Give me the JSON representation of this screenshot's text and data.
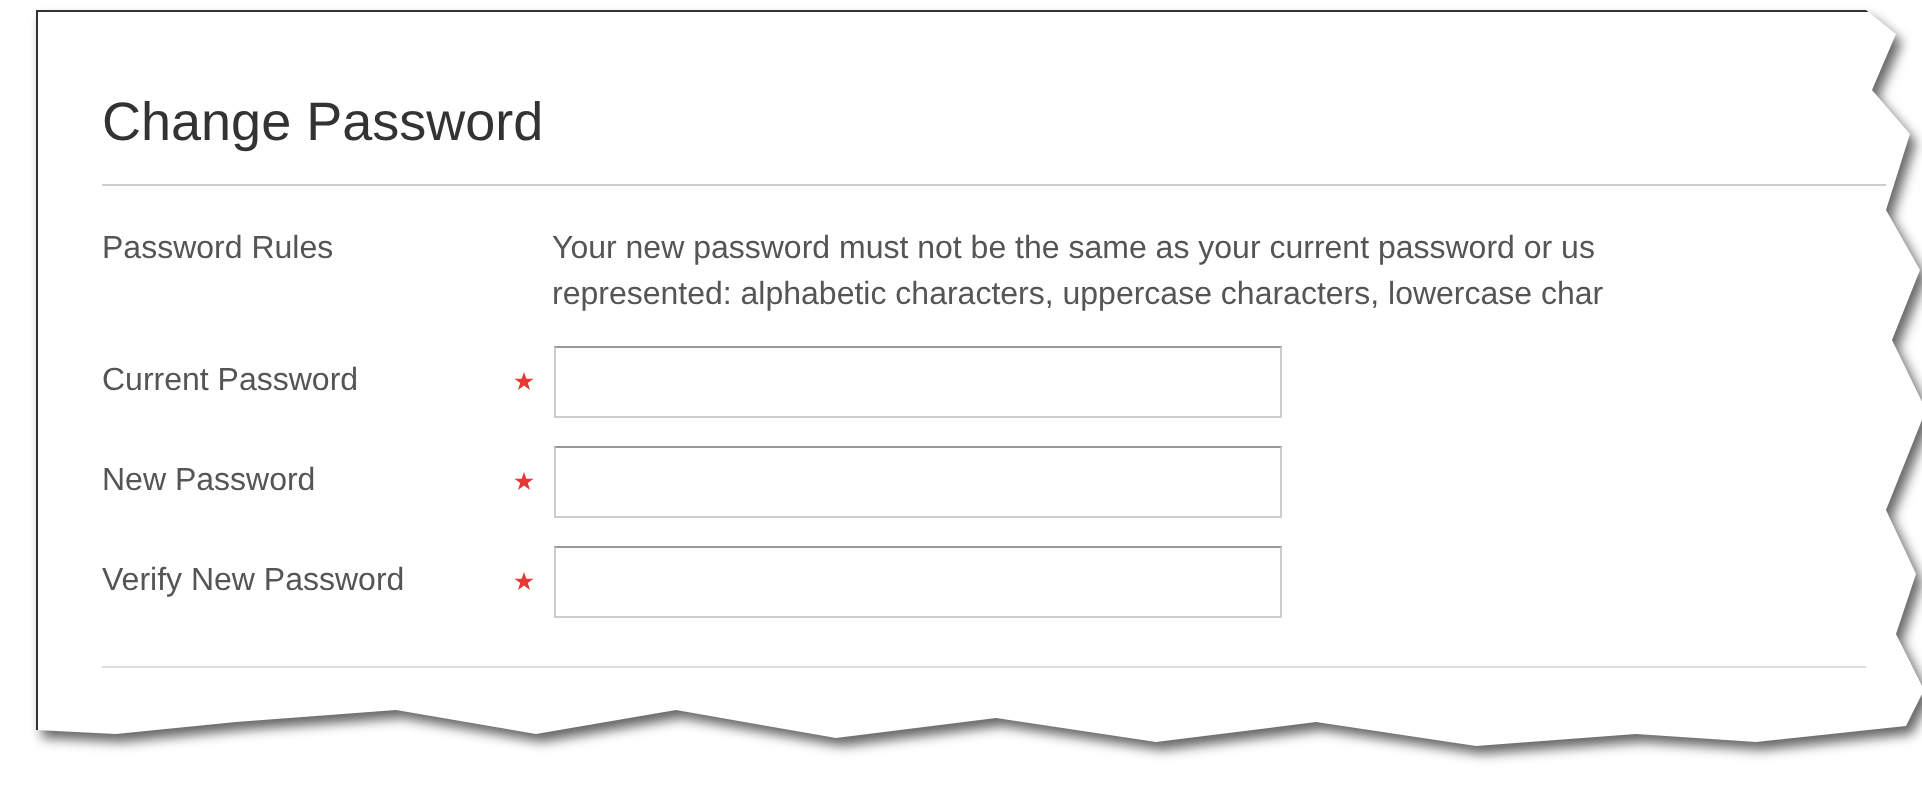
{
  "title": "Change Password",
  "rules": {
    "label": "Password Rules",
    "lines": [
      "Your new password must not be the same as your current password or us",
      "represented: alphabetic characters, uppercase characters, lowercase char"
    ]
  },
  "fields": [
    {
      "label": "Current Password",
      "required": true
    },
    {
      "label": "New Password",
      "required": true
    },
    {
      "label": "Verify New Password",
      "required": true
    }
  ]
}
